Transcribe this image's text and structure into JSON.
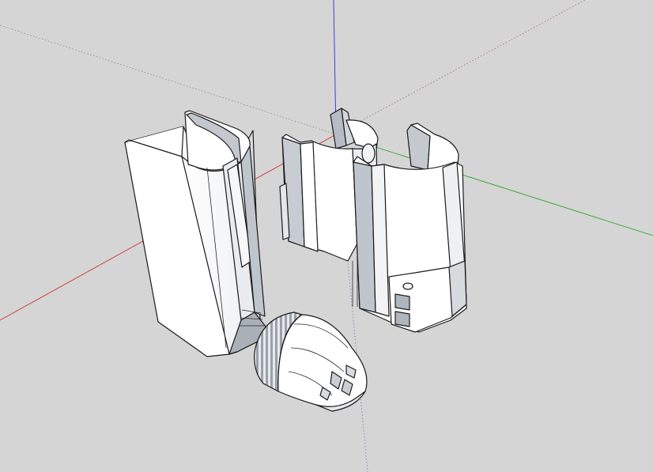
{
  "scene": {
    "background": "#d5d5d5",
    "face_color": "#ffffff",
    "shade_color": "#b8bec6",
    "edge_color": "#1a1a1a"
  },
  "axes": {
    "red": "#d22d2d",
    "green": "#2fa52f",
    "blue": "#2d2dd2"
  },
  "models": [
    {
      "id": "half-shell-left"
    },
    {
      "id": "clip-shell"
    },
    {
      "id": "battery-shell"
    },
    {
      "id": "nozzle-cap"
    }
  ]
}
